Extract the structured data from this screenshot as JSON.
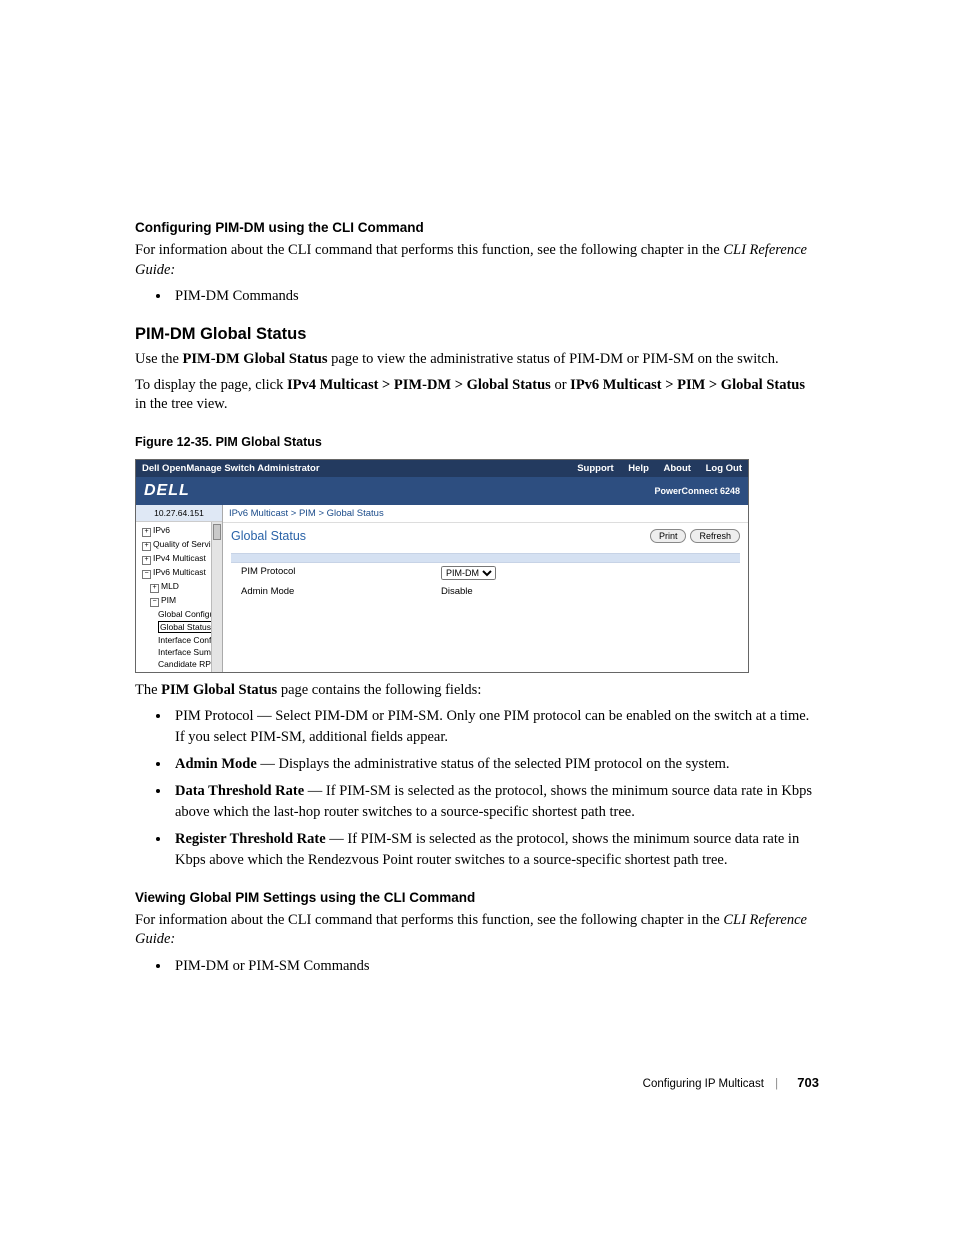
{
  "headings": {
    "cli1": "Configuring PIM-DM using the CLI Command",
    "pim_global": "PIM-DM Global Status",
    "view_cli": "Viewing Global PIM Settings using the CLI Command"
  },
  "paras": {
    "cli_intro": "For information about the CLI command that performs this function, see the following chapter in the ",
    "cli_ref": "CLI Reference Guide:",
    "pim_use_pre": "Use the ",
    "pim_use_bold": "PIM-DM Global Status",
    "pim_use_post": " page to view the administrative status of PIM-DM or PIM-SM on the switch.",
    "display_pre": "To display the page, click ",
    "display_path1": "IPv4 Multicast > PIM-DM > Global Status",
    "display_or": " or ",
    "display_path2": "IPv6 Multicast > PIM > Global Status",
    "display_post": " in the tree view.",
    "contains_pre": "The ",
    "contains_bold": "PIM Global Status",
    "contains_post": " page contains the following fields:"
  },
  "bullets1": {
    "0": "PIM-DM Commands"
  },
  "bullets2": {
    "0": "PIM Protocol — Select PIM-DM or PIM-SM. Only one PIM protocol can be enabled on the switch at a time. If you select PIM-SM, additional fields appear.",
    "1_bold": "Admin Mode",
    "1_rest": " — Displays the administrative status of the selected PIM protocol on the system.",
    "2_bold": "Data Threshold Rate",
    "2_rest": " — If PIM-SM is selected as the protocol, shows the minimum source data rate in Kbps above which the last-hop router switches to a source-specific shortest path tree.",
    "3_bold": "Register Threshold Rate",
    "3_rest": " — If PIM-SM is selected as the protocol, shows the minimum source data rate in Kbps above which the Rendezvous Point router switches to a source-specific shortest path tree."
  },
  "bullets3": {
    "0": "PIM-DM or PIM-SM Commands"
  },
  "fig_caption": "Figure 12-35.    PIM Global Status",
  "shot": {
    "app_title": "Dell OpenManage Switch Administrator",
    "top_links": {
      "support": "Support",
      "help": "Help",
      "about": "About",
      "logout": "Log Out"
    },
    "brand": "DELL",
    "model": "PowerConnect 6248",
    "ip": "10.27.64.151",
    "tree": {
      "i0": "IPv6",
      "i1": "Quality of Service",
      "i2": "IPv4 Multicast",
      "i3": "IPv6 Multicast",
      "i4": "MLD",
      "i5": "PIM",
      "i6": "Global Configur",
      "i7": "Global Status",
      "i8": "Interface Config",
      "i9": "Interface Summ",
      "i10": "Candidate RP C"
    },
    "crumb": "IPv6 Multicast > PIM > Global Status",
    "title": "Global Status",
    "buttons": {
      "print": "Print",
      "refresh": "Refresh"
    },
    "rows": {
      "pim_protocol_label": "PIM Protocol",
      "pim_protocol_value": "PIM-DM",
      "admin_mode_label": "Admin Mode",
      "admin_mode_value": "Disable"
    }
  },
  "footer": {
    "chapter": "Configuring IP Multicast",
    "page": "703"
  }
}
